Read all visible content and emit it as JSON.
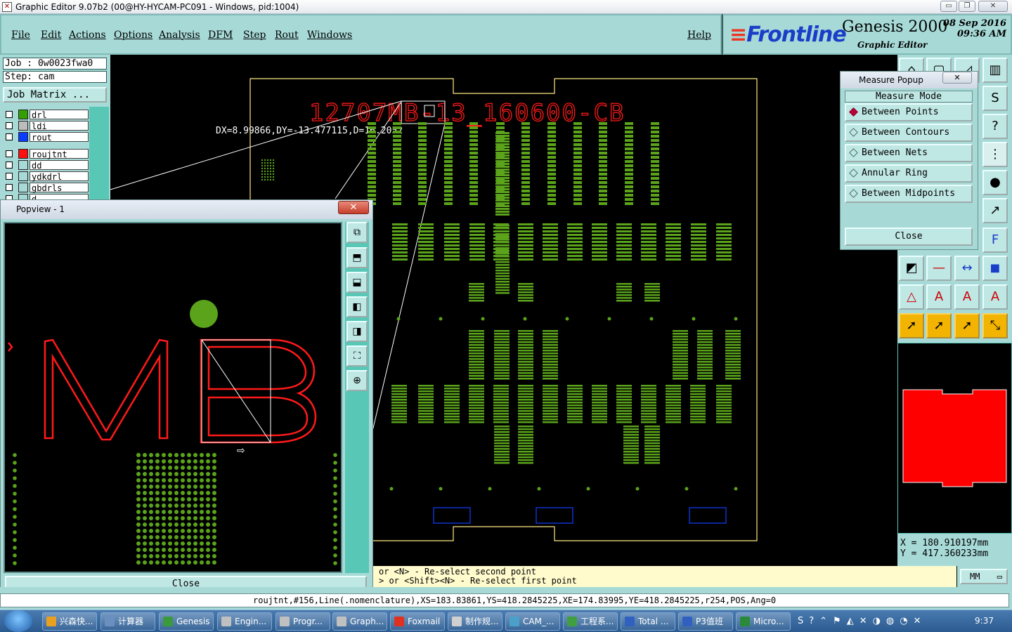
{
  "window": {
    "title": "Graphic Editor 9.07b2 (00@HY-HYCAM-PC091 - Windows, pid:1004)",
    "controls": {
      "minimize": "▭",
      "maximize": "❐",
      "close": "✕"
    }
  },
  "menu": {
    "items": [
      "File",
      "Edit",
      "Actions",
      "Options",
      "Analysis",
      "DFM",
      "Step",
      "Rout",
      "Windows"
    ],
    "help": "Help"
  },
  "brand": {
    "logo": "Frontline",
    "product": "Genesis 2000",
    "subtitle": "Graphic Editor",
    "date": "08 Sep 2016",
    "time": "09:36 AM"
  },
  "job": {
    "job": "Job : 0w0023fwa0",
    "step": "Step: cam",
    "matrix_button": "Job Matrix ..."
  },
  "layers": [
    {
      "name": "drl",
      "color": "#33a000"
    },
    {
      "name": "ldi",
      "color": "#bcbcbc"
    },
    {
      "name": "rout",
      "color": "#0a3cff"
    },
    {
      "name": "roujtnt",
      "color": "#ff1010"
    },
    {
      "name": "dd",
      "color": "#a7dad7"
    },
    {
      "name": "ydkdrl",
      "color": "#a7dad7"
    },
    {
      "name": "gbdrls",
      "color": "#a7dad7"
    },
    {
      "name": "d",
      "color": "#a7dad7"
    }
  ],
  "canvas": {
    "board_text": "12707MB-13_160600-CB",
    "measure_readout": "DX=8.99866,DY=-13.477115,D=16.2052",
    "colors": {
      "board": "#ffea80",
      "pads": "#5aa31b",
      "text": "#ff1a1a",
      "boxes": "#1040ff"
    }
  },
  "popview": {
    "title": "Popview - 1",
    "close_label": "Close",
    "tools": [
      "zoom-window-icon",
      "pan-up-icon",
      "pan-down-icon",
      "pan-left-icon",
      "pan-right-icon",
      "zoom-fit-icon",
      "zoom-center-icon"
    ]
  },
  "measure_popup": {
    "title": "Measure Popup",
    "mode_header": "Measure Mode",
    "options": [
      "Between Points",
      "Between Contours",
      "Between Nets",
      "Annular Ring",
      "Between Midpoints"
    ],
    "selected": "Between Points",
    "close_label": "Close"
  },
  "coords": {
    "x": "X = 180.910197mm",
    "y": "Y = 417.360233mm"
  },
  "messages": {
    "line1": "or <N> - Re-select second point",
    "line2": "> or <Shift><N> - Re-select first point"
  },
  "units": "MM",
  "command_line": "roujtnt,#156,Line(.nomenclature),XS=183.83861,YS=418.2845225,XE=174.83995,YE=418.2845225,r254,POS,Ang=0",
  "taskbar": {
    "items": [
      {
        "label": "兴森快...",
        "color": "#e8a020"
      },
      {
        "label": "计算器",
        "color": "#6a8fc0"
      },
      {
        "label": "Genesis",
        "color": "#3b9a3b"
      },
      {
        "label": "Engin...",
        "color": "#c0c0c0"
      },
      {
        "label": "Progr...",
        "color": "#c0c0c0"
      },
      {
        "label": "Graph...",
        "color": "#c0c0c0"
      },
      {
        "label": "Foxmail",
        "color": "#e03020"
      },
      {
        "label": "制作规...",
        "color": "#d0d0d0"
      },
      {
        "label": "CAM_...",
        "color": "#4aa0c8"
      },
      {
        "label": "工程系...",
        "color": "#40a040"
      },
      {
        "label": "Total ...",
        "color": "#3060c0"
      },
      {
        "label": "P3值班",
        "color": "#3060c0"
      },
      {
        "label": "Micro...",
        "color": "#2a8a3a"
      }
    ],
    "clock": "9:37"
  }
}
